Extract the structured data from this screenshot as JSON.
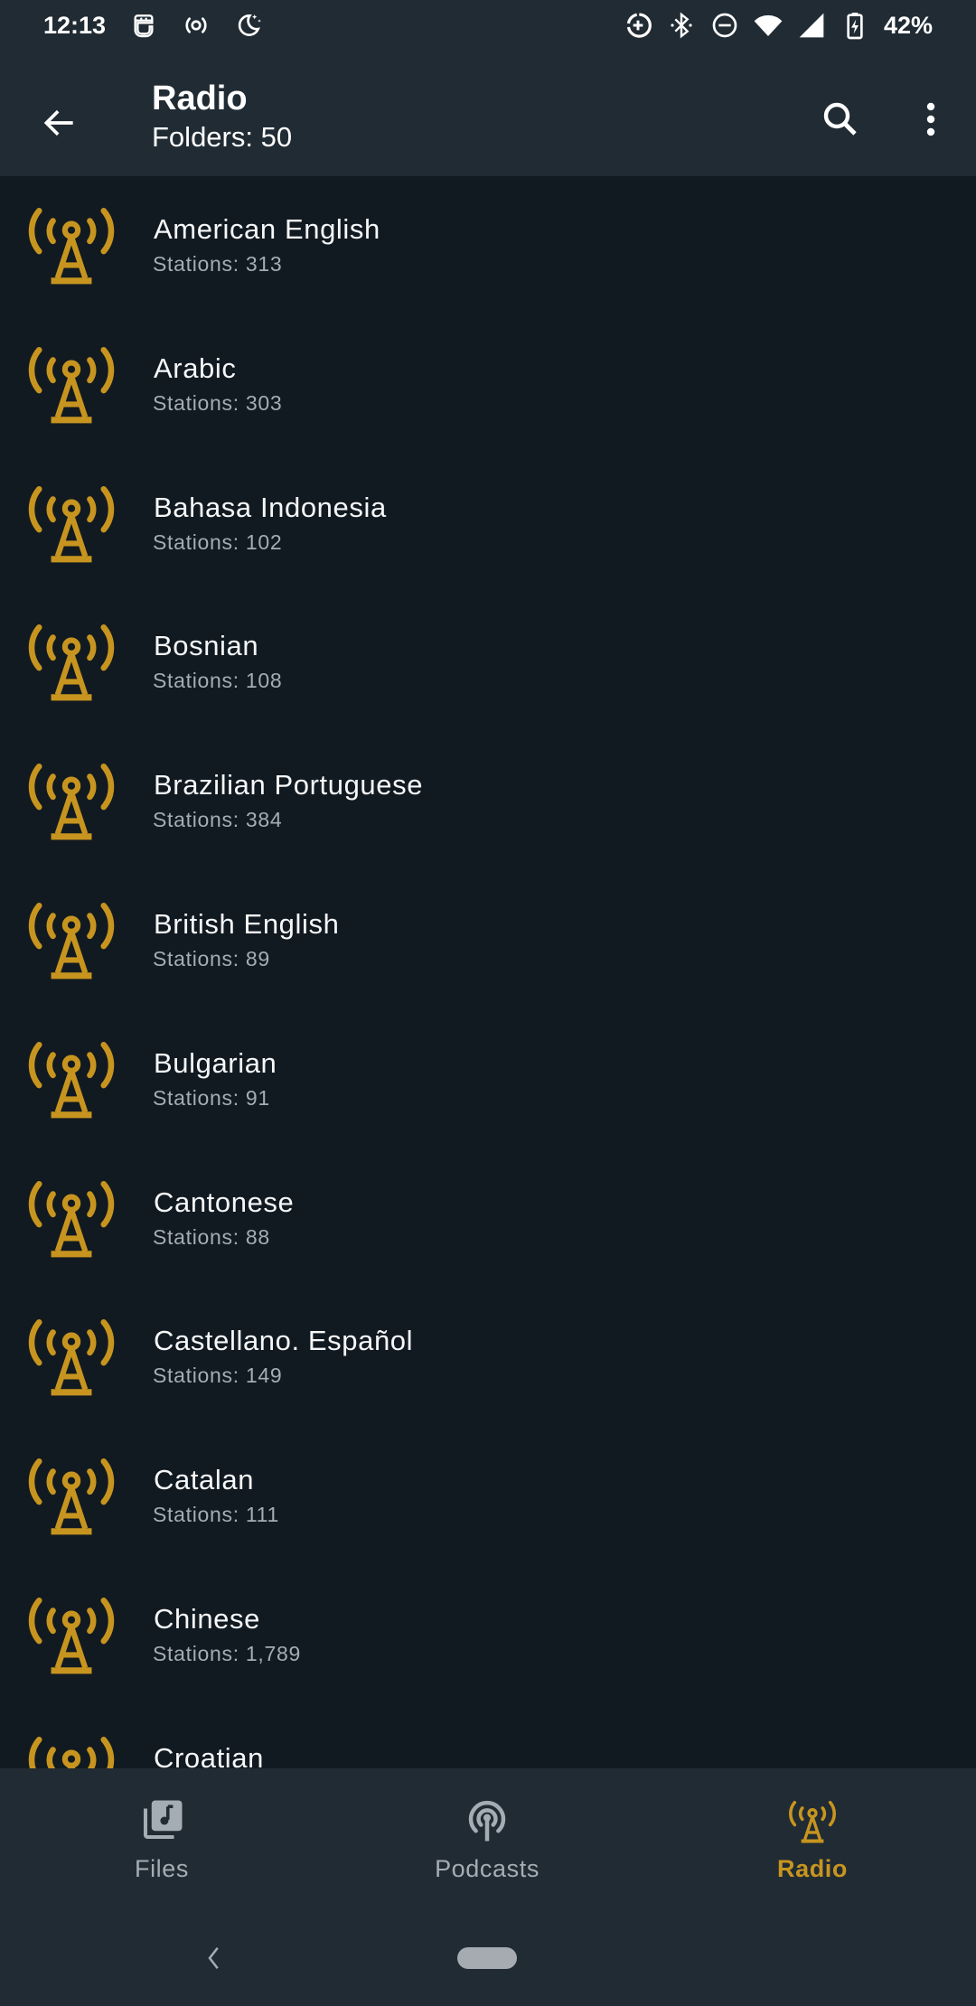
{
  "status_bar": {
    "time": "12:13",
    "battery_percent": "42%",
    "left_icons": [
      "assistant-icon",
      "hotspot-icon",
      "bedtime-icon"
    ],
    "right_icons": [
      "data-saver-icon",
      "bluetooth-icon",
      "do-not-disturb-icon",
      "wifi-icon",
      "cell-signal-icon",
      "battery-charging-icon"
    ]
  },
  "app_bar": {
    "title": "Radio",
    "subtitle": "Folders: 50",
    "back_icon": "arrow-back-icon",
    "search_icon": "search-icon",
    "more_icon": "more-vert-icon"
  },
  "list": {
    "item_icon": "radio-tower-icon",
    "items": [
      {
        "title": "American English",
        "subtitle": "Stations: 313"
      },
      {
        "title": "Arabic",
        "subtitle": "Stations: 303"
      },
      {
        "title": "Bahasa Indonesia",
        "subtitle": "Stations: 102"
      },
      {
        "title": "Bosnian",
        "subtitle": "Stations: 108"
      },
      {
        "title": "Brazilian Portuguese",
        "subtitle": "Stations: 384"
      },
      {
        "title": "British English",
        "subtitle": "Stations: 89"
      },
      {
        "title": "Bulgarian",
        "subtitle": "Stations: 91"
      },
      {
        "title": "Cantonese",
        "subtitle": "Stations: 88"
      },
      {
        "title": "Castellano. Español",
        "subtitle": "Stations: 149"
      },
      {
        "title": "Catalan",
        "subtitle": "Stations: 111"
      },
      {
        "title": "Chinese",
        "subtitle": "Stations: 1,789"
      },
      {
        "title": "Croatian",
        "subtitle": ""
      }
    ]
  },
  "bottom_nav": {
    "tabs": [
      {
        "label": "Files",
        "icon": "music-library-icon",
        "active": false
      },
      {
        "label": "Podcasts",
        "icon": "podcast-icon",
        "active": false
      },
      {
        "label": "Radio",
        "icon": "radio-tower-icon",
        "active": true
      }
    ]
  },
  "colors": {
    "accent": "#c7951f",
    "bar_background": "#212b33",
    "list_background": "#121a21",
    "secondary_text": "#a5adb4"
  }
}
